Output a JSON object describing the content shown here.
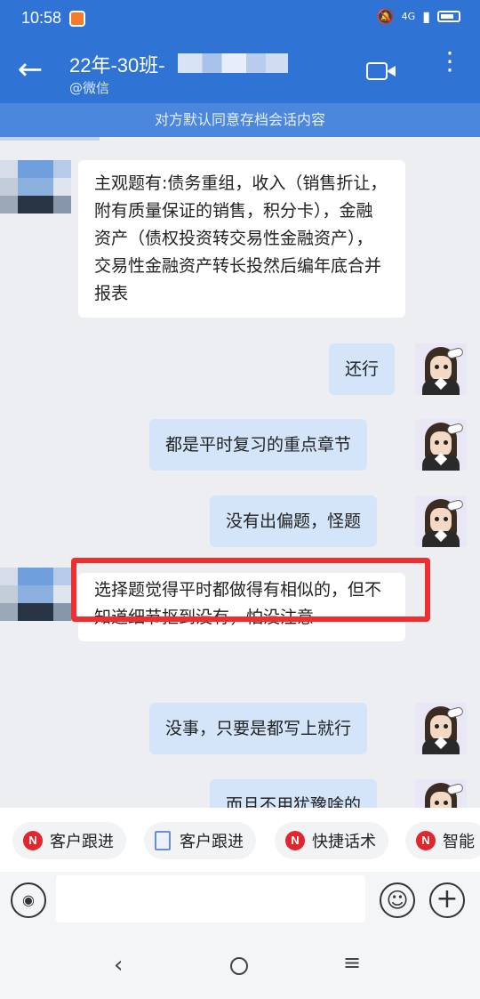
{
  "status_bar": {
    "time": "10:58",
    "signal_text": "4G"
  },
  "header": {
    "title": "22年-30班-",
    "subtitle": "@微信"
  },
  "notice": "对方默认同意存档会话内容",
  "messages": [
    {
      "side": "left",
      "text": "主观题有:债务重组，收入（销售折让，附有质量保证的销售，积分卡），金融资产（债权投资转交易性金融资产），交易性金融资产转长投然后编年底合并报表"
    },
    {
      "side": "right",
      "text": "还行"
    },
    {
      "side": "right",
      "text": "都是平时复习的重点章节"
    },
    {
      "side": "right",
      "text": "没有出偏题，怪题"
    },
    {
      "side": "left",
      "text": "选择题觉得平时都做得有相似的，但不知道细节抠到没有，怕没注意"
    },
    {
      "side": "right",
      "text": "没事，只要是都写上就行"
    },
    {
      "side": "right",
      "text": "而且不用犹豫啥的"
    }
  ],
  "quick_actions": [
    {
      "label": "客户跟进",
      "icon": "brand-logo-icon"
    },
    {
      "label": "客户跟进",
      "icon": "document-icon"
    },
    {
      "label": "快捷话术",
      "icon": "brand-logo-icon"
    },
    {
      "label": "智能",
      "icon": "brand-logo-icon"
    }
  ],
  "colors": {
    "header_blue": "#2f73d5",
    "notice_blue": "#4b87dd",
    "bubble_out": "#d4e5fa",
    "highlight_red": "#ef2f2f",
    "brand_red": "#e3262e"
  }
}
